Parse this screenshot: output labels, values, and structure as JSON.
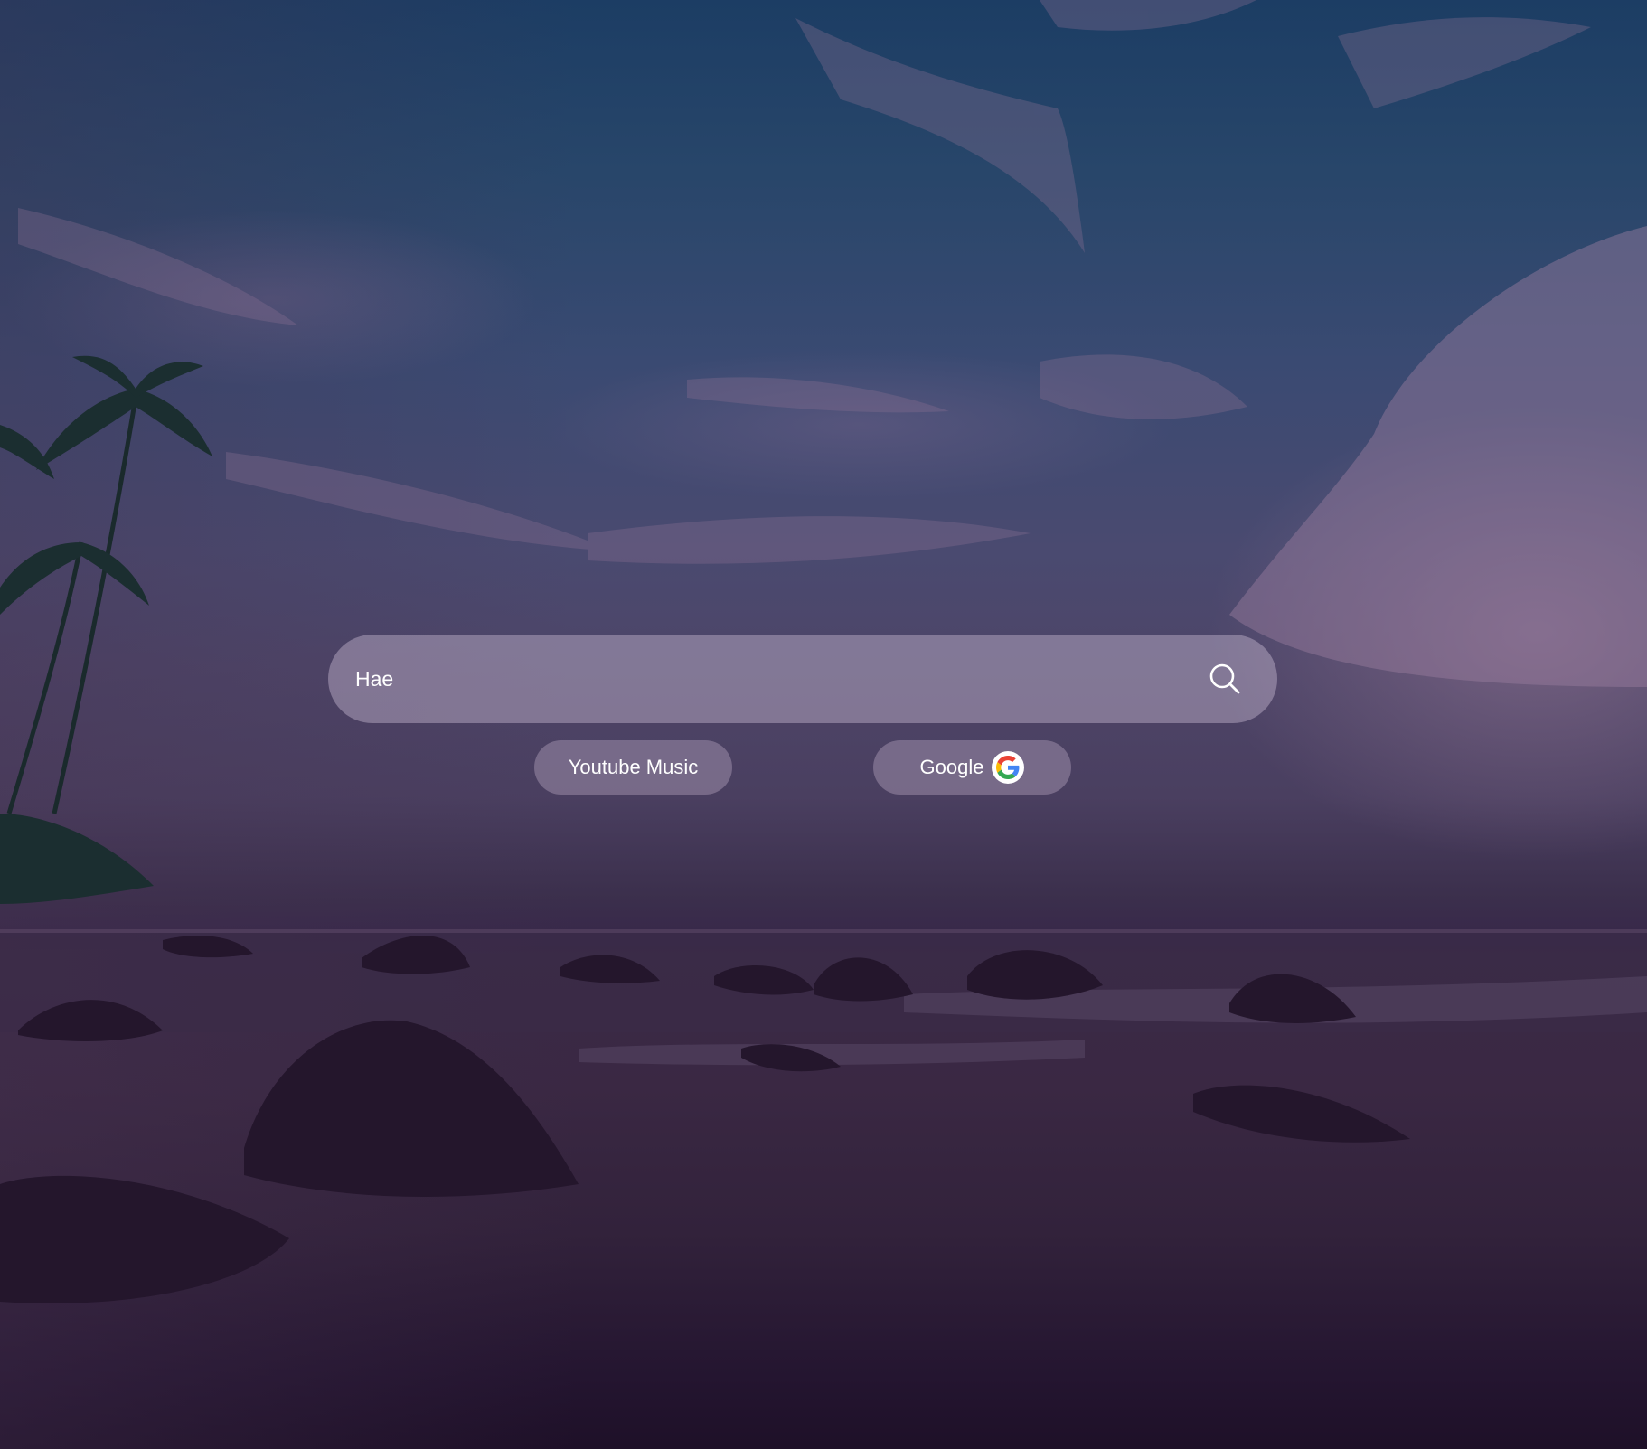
{
  "search": {
    "value": "Hae",
    "placeholder": ""
  },
  "shortcuts": [
    {
      "label": "Youtube Music",
      "icon": null
    },
    {
      "label": "Google",
      "icon": "google-g-logo"
    }
  ],
  "icons": {
    "search": "search-icon",
    "google": "google-logo-icon"
  },
  "colors": {
    "sky_top": "#1c3d64",
    "sky_mid": "#4a4a70",
    "ground": "#3a2843",
    "text": "#ffffff",
    "google_blue": "#4285F4",
    "google_red": "#EA4335",
    "google_yellow": "#FBBC05",
    "google_green": "#34A853"
  }
}
